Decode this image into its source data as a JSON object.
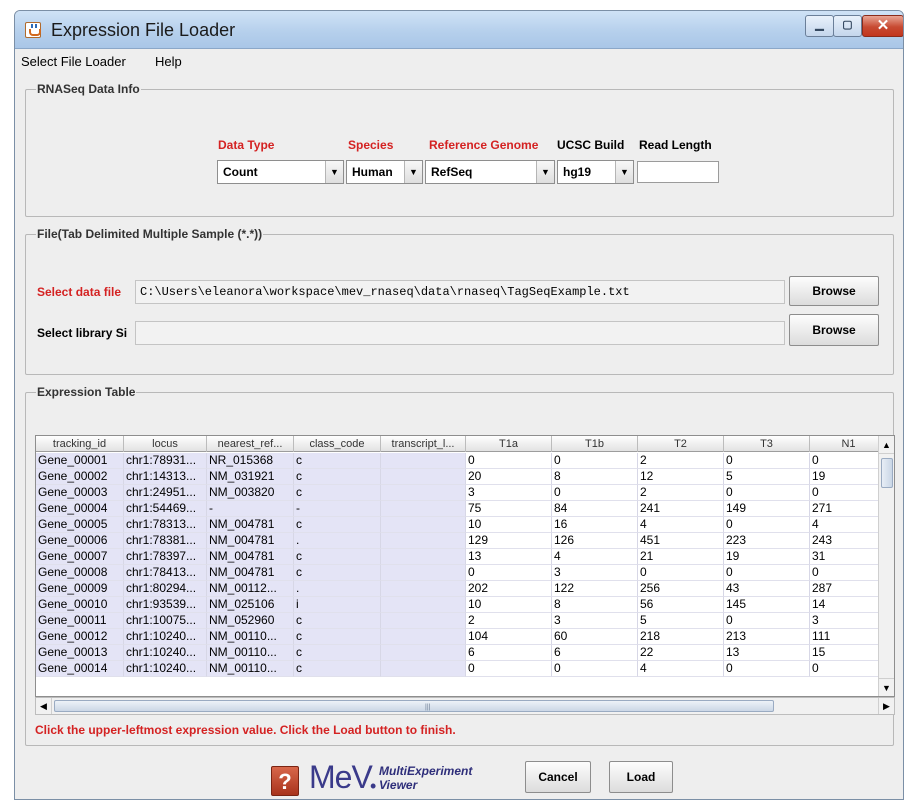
{
  "window": {
    "title": "Expression File Loader"
  },
  "menubar": {
    "items": [
      "Select File Loader",
      "Help"
    ]
  },
  "rnaseq_group": {
    "title": "RNASeq Data Info",
    "data_type": {
      "label": "Data Type",
      "value": "Count"
    },
    "species": {
      "label": "Species",
      "value": "Human"
    },
    "reference_genome": {
      "label": "Reference Genome",
      "value": "RefSeq"
    },
    "ucsc_build": {
      "label": "UCSC Build",
      "value": "hg19"
    },
    "read_length": {
      "label": "Read Length",
      "value": ""
    }
  },
  "file_group": {
    "title": "File(Tab Delimited Multiple Sample (*.*))",
    "data_file": {
      "label": "Select data file",
      "path": "C:\\Users\\eleanora\\workspace\\mev_rnaseq\\data\\rnaseq\\TagSeqExample.txt",
      "browse_label": "Browse"
    },
    "library": {
      "label": "Select library Si",
      "path": "",
      "browse_label": "Browse"
    }
  },
  "table_group": {
    "title": "Expression Table",
    "columns": [
      "tracking_id",
      "locus",
      "nearest_ref...",
      "class_code",
      "transcript_l...",
      "T1a",
      "T1b",
      "T2",
      "T3",
      "N1"
    ],
    "rows": [
      [
        "Gene_00001",
        "chr1:78931...",
        "NR_015368",
        "c",
        "",
        "0",
        "0",
        "2",
        "0",
        "0"
      ],
      [
        "Gene_00002",
        "chr1:14313...",
        "NM_031921",
        "c",
        "",
        "20",
        "8",
        "12",
        "5",
        "19"
      ],
      [
        "Gene_00003",
        "chr1:24951...",
        "NM_003820",
        "c",
        "",
        "3",
        "0",
        "2",
        "0",
        "0"
      ],
      [
        "Gene_00004",
        "chr1:54469...",
        "-",
        "-",
        "",
        "75",
        "84",
        "241",
        "149",
        "271"
      ],
      [
        "Gene_00005",
        "chr1:78313...",
        "NM_004781",
        "c",
        "",
        "10",
        "16",
        "4",
        "0",
        "4"
      ],
      [
        "Gene_00006",
        "chr1:78381...",
        "NM_004781",
        ".",
        "",
        "129",
        "126",
        "451",
        "223",
        "243"
      ],
      [
        "Gene_00007",
        "chr1:78397...",
        "NM_004781",
        "c",
        "",
        "13",
        "4",
        "21",
        "19",
        "31"
      ],
      [
        "Gene_00008",
        "chr1:78413...",
        "NM_004781",
        "c",
        "",
        "0",
        "3",
        "0",
        "0",
        "0"
      ],
      [
        "Gene_00009",
        "chr1:80294...",
        "NM_00112...",
        ".",
        "",
        "202",
        "122",
        "256",
        "43",
        "287"
      ],
      [
        "Gene_00010",
        "chr1:93539...",
        "NM_025106",
        "i",
        "",
        "10",
        "8",
        "56",
        "145",
        "14"
      ],
      [
        "Gene_00011",
        "chr1:10075...",
        "NM_052960",
        "c",
        "",
        "2",
        "3",
        "5",
        "0",
        "3"
      ],
      [
        "Gene_00012",
        "chr1:10240...",
        "NM_00110...",
        "c",
        "",
        "104",
        "60",
        "218",
        "213",
        "111"
      ],
      [
        "Gene_00013",
        "chr1:10240...",
        "NM_00110...",
        "c",
        "",
        "6",
        "6",
        "22",
        "13",
        "15"
      ],
      [
        "Gene_00014",
        "chr1:10240...",
        "NM_00110...",
        "c",
        "",
        "0",
        "0",
        "4",
        "0",
        "0"
      ]
    ]
  },
  "instruction": "Click the upper-leftmost expression value. Click the Load button to finish.",
  "footer": {
    "help_icon": "?",
    "logo": {
      "main": "MeV",
      "dot": "•",
      "sub1": "MultiExperiment",
      "sub2": "Viewer"
    },
    "cancel_label": "Cancel",
    "load_label": "Load"
  },
  "colors": {
    "accent_red": "#d42222",
    "text_column_bg": "#e4e4f6"
  }
}
